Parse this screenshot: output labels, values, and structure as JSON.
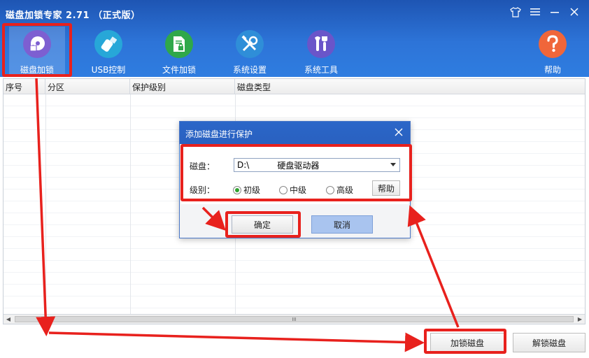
{
  "app": {
    "title": "磁盘加锁专家 2.71 （正式版）"
  },
  "window_controls": [
    "shirt-icon",
    "menu-icon",
    "minimize-icon",
    "close-icon"
  ],
  "toolbar": {
    "items": [
      {
        "label": "磁盘加锁",
        "icon": "disk-lock-icon",
        "color": "#7d5fd1"
      },
      {
        "label": "USB控制",
        "icon": "usb-icon",
        "color": "#27a7d8"
      },
      {
        "label": "文件加锁",
        "icon": "file-lock-icon",
        "color": "#2fa84a"
      },
      {
        "label": "系统设置",
        "icon": "tools-icon",
        "color": "#2f8ed8"
      },
      {
        "label": "系统工具",
        "icon": "wrench-icon",
        "color": "#6a55c9"
      },
      {
        "label": "帮助",
        "icon": "help-icon",
        "color": "#f0663a"
      }
    ]
  },
  "table": {
    "columns": [
      "序号",
      "分区",
      "保护级别",
      "磁盘类型"
    ]
  },
  "dialog": {
    "title": "添加磁盘进行保护",
    "disk_label": "磁盘：",
    "disk_value": "D:\\",
    "disk_type": "硬盘驱动器",
    "level_label": "级别：",
    "levels": [
      "初级",
      "中级",
      "高级"
    ],
    "selected_level": "初级",
    "help_label": "帮助",
    "ok_label": "确定",
    "cancel_label": "取消"
  },
  "footer": {
    "lock_label": "加锁磁盘",
    "unlock_label": "解锁磁盘"
  },
  "scrollbar": {
    "thumb_glyph": "III"
  },
  "colors": {
    "header": "#2d74d8",
    "annotation": "#e8211d"
  }
}
